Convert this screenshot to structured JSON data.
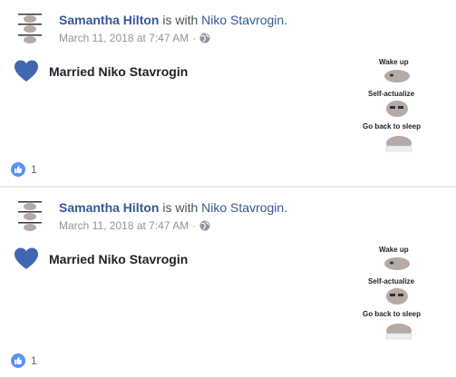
{
  "posts": [
    {
      "author": "Samantha Hilton",
      "with_text": " is with ",
      "tagged": "Niko Stavrogin",
      "period": ".",
      "timestamp": "March 11, 2018 at 7:47 AM",
      "separator": "·",
      "audience_icon": "globe-icon",
      "life_event_icon": "heart-icon",
      "life_event": "Married Niko Stavrogin",
      "meme_lines": [
        "Wake up",
        "Self-actualize",
        "Go back to sleep"
      ],
      "like_count": "1"
    },
    {
      "author": "Samantha Hilton",
      "with_text": " is with ",
      "tagged": "Niko Stavrogin",
      "period": ".",
      "timestamp": "March 11, 2018 at 7:47 AM",
      "separator": "·",
      "audience_icon": "globe-icon",
      "life_event_icon": "heart-icon",
      "life_event": "Married Niko Stavrogin",
      "meme_lines": [
        "Wake up",
        "Self-actualize",
        "Go back to sleep"
      ],
      "like_count": "1"
    }
  ],
  "colors": {
    "link": "#365899",
    "heart": "#4267b2",
    "like_badge": "#5890ff",
    "meta": "#90949c"
  }
}
